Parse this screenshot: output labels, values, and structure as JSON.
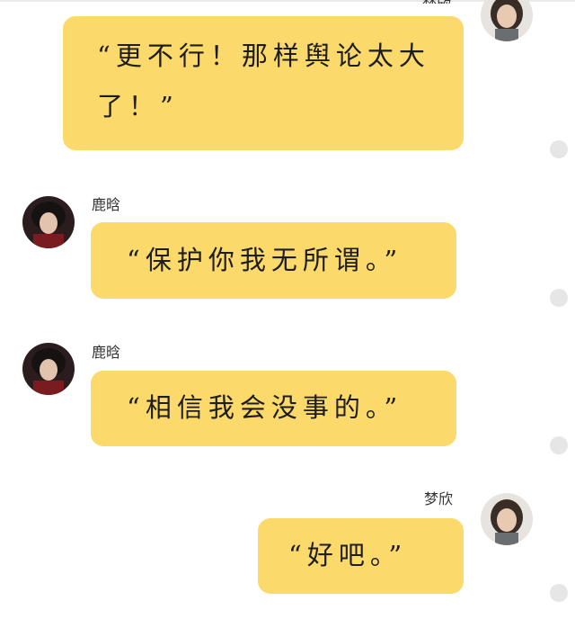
{
  "messages": [
    {
      "sender": "梦欣",
      "side": "right",
      "text": "“更不行！那样舆论太大了！”",
      "sender_name_visible": false
    },
    {
      "sender": "鹿晗",
      "side": "left",
      "text": "“保护你我无所谓。”",
      "sender_name_visible": true
    },
    {
      "sender": "鹿晗",
      "side": "left",
      "text": "“相信我会没事的。”",
      "sender_name_visible": true
    },
    {
      "sender": "梦欣",
      "side": "right",
      "text": "“好吧。”",
      "sender_name_visible": true
    }
  ],
  "colors": {
    "bubble": "#fbd96a",
    "background": "#ffffff",
    "dot": "#e6e6e6"
  }
}
